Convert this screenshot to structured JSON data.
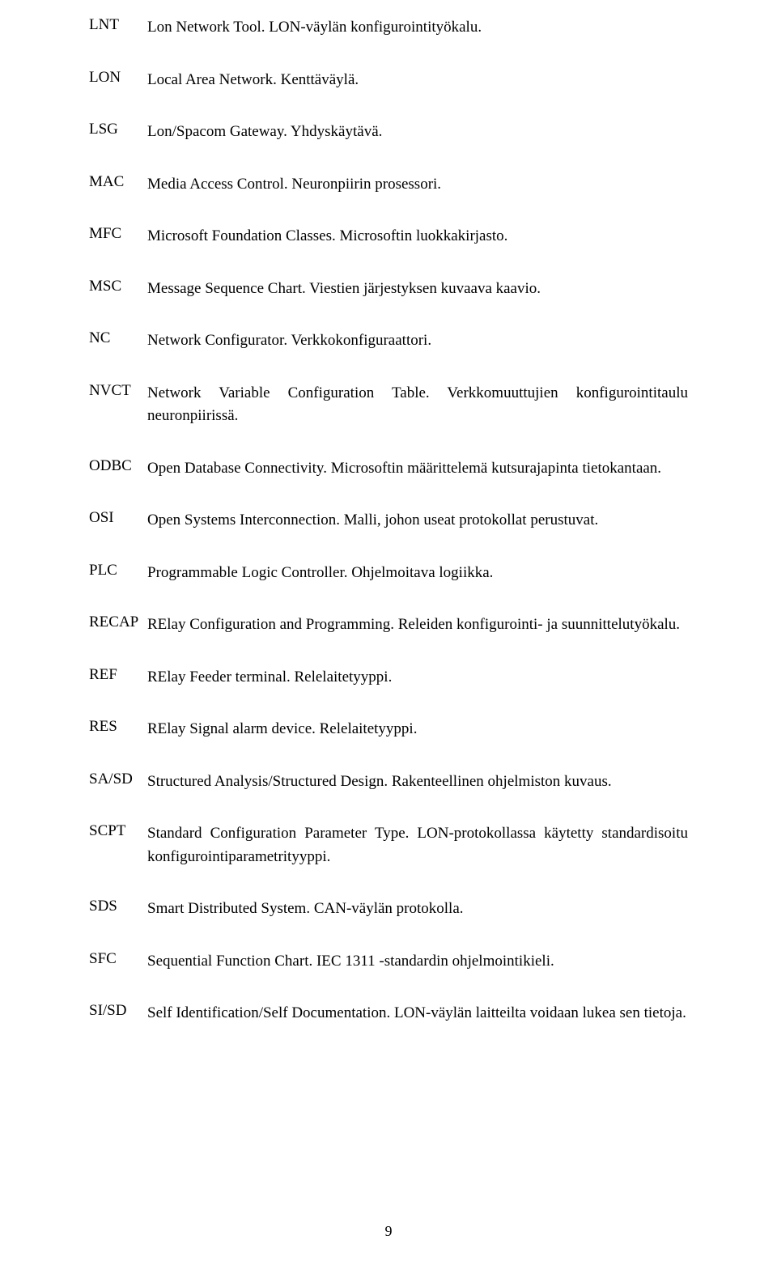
{
  "entries": [
    {
      "acronym": "LNT",
      "definition": "Lon Network Tool. LON-väylän konfigurointityökalu."
    },
    {
      "acronym": "LON",
      "definition": "Local Area Network. Kenttäväylä."
    },
    {
      "acronym": "LSG",
      "definition": "Lon/Spacom Gateway. Yhdyskäytävä."
    },
    {
      "acronym": "MAC",
      "definition": "Media Access Control. Neuronpiirin prosessori."
    },
    {
      "acronym": "MFC",
      "definition": "Microsoft Foundation Classes. Microsoftin luokkakirjasto."
    },
    {
      "acronym": "MSC",
      "definition": "Message Sequence Chart. Viestien järjestyksen kuvaava kaavio."
    },
    {
      "acronym": "NC",
      "definition": "Network Configurator. Verkkokonfiguraattori."
    },
    {
      "acronym": "NVCT",
      "definition": "Network Variable Configuration Table. Verkkomuuttujien konfigurointitaulu neuronpiirissä."
    },
    {
      "acronym": "ODBC",
      "definition": "Open Database Connectivity. Microsoftin määrittelemä kutsurajapinta tietokantaan."
    },
    {
      "acronym": "OSI",
      "definition": "Open Systems Interconnection. Malli, johon useat protokollat perustuvat."
    },
    {
      "acronym": "PLC",
      "definition": "Programmable Logic Controller. Ohjelmoitava logiikka."
    },
    {
      "acronym": "RECAP",
      "definition": "RElay Configuration and Programming. Releiden konfigurointi- ja suunnittelutyökalu."
    },
    {
      "acronym": "REF",
      "definition": "RElay Feeder terminal. Relelaitetyyppi."
    },
    {
      "acronym": "RES",
      "definition": "RElay Signal alarm device. Relelaitetyyppi."
    },
    {
      "acronym": "SA/SD",
      "definition": "Structured Analysis/Structured Design. Rakenteellinen ohjelmiston kuvaus."
    },
    {
      "acronym": "SCPT",
      "definition": "Standard Configuration Parameter Type. LON-protokollassa käytetty standardisoitu konfigurointiparametrityyppi."
    },
    {
      "acronym": "SDS",
      "definition": "Smart Distributed System. CAN-väylän protokolla."
    },
    {
      "acronym": "SFC",
      "definition": "Sequential Function Chart. IEC 1311 -standardin ohjelmointikieli."
    },
    {
      "acronym": "SI/SD",
      "definition": "Self Identification/Self Documentation. LON-väylän laitteilta voidaan lukea sen tietoja."
    }
  ],
  "page_number": "9"
}
